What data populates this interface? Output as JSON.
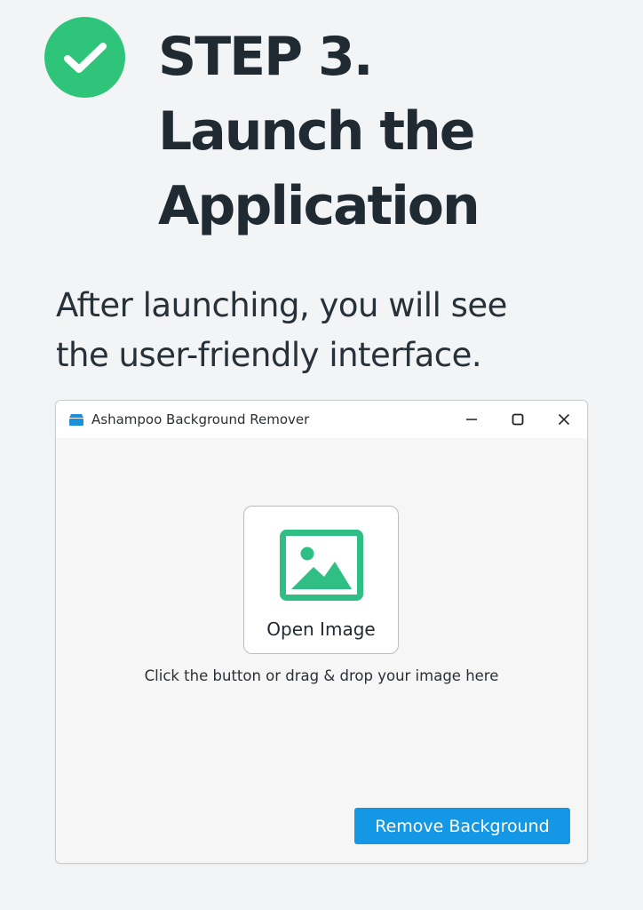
{
  "step": {
    "badge_icon": "check-icon",
    "badge_color": "#2ec57a",
    "title_lines": [
      "STEP 3.",
      "Launch the",
      "Application"
    ]
  },
  "intro": {
    "lines": [
      "After launching, you will see",
      "the user-friendly interface."
    ]
  },
  "window": {
    "title": "Ashampoo Background Remover",
    "app_icon": "app-icon",
    "controls": {
      "minimize_icon": "minimize-icon",
      "maximize_icon": "maximize-icon",
      "close_icon": "close-icon"
    },
    "open_image": {
      "icon": "image-icon",
      "label": "Open Image",
      "accent": "#2fbf85"
    },
    "drop_hint": "Click the button or drag & drop your image here",
    "remove_button": {
      "label": "Remove Background",
      "color": "#1497e4"
    }
  }
}
